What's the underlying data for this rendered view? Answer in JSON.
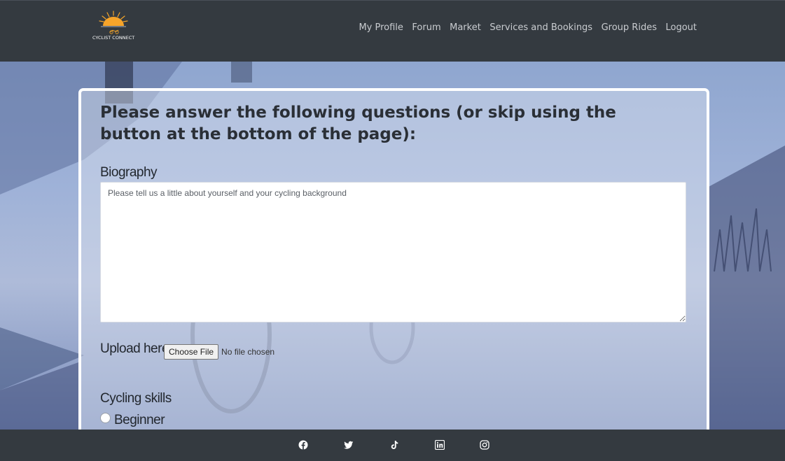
{
  "header": {
    "logo_text": "CYCLIST CONNECT",
    "nav": [
      "My Profile",
      "Forum",
      "Market",
      "Services and Bookings",
      "Group Rides",
      "Logout"
    ]
  },
  "form": {
    "title": "Please answer the following questions (or skip using the button at the bottom of the page):",
    "biography_label": "Biography",
    "biography_placeholder": "Please tell us a little about yourself and your cycling background",
    "upload_label": "Upload here:",
    "file_button": "Choose File",
    "file_status": "No file chosen",
    "skills_label": "Cycling skills",
    "skill_options": [
      "Beginner"
    ]
  },
  "footer": {
    "social_icons": [
      "facebook-icon",
      "twitter-icon",
      "tiktok-icon",
      "linkedin-icon",
      "instagram-icon"
    ]
  },
  "colors": {
    "header_bg": "#343a40",
    "nav_text": "#c9ccd0",
    "card_border": "#ffffff",
    "hero_tint": "#9fb2d8"
  }
}
